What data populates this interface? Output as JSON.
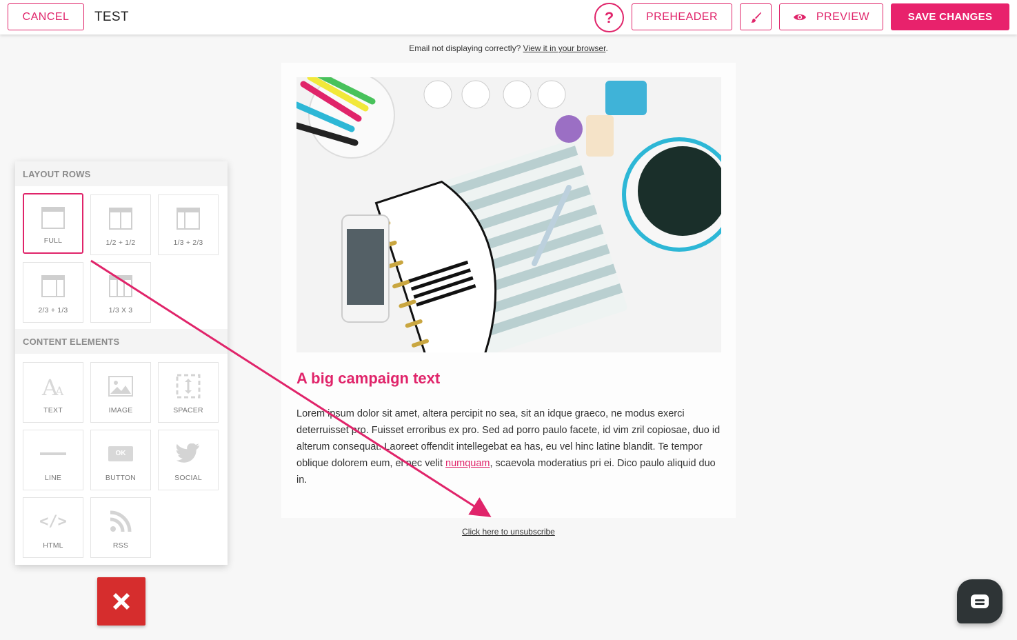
{
  "toolbar": {
    "cancel_label": "CANCEL",
    "title": "TEST",
    "help_label": "?",
    "preheader_label": "PREHEADER",
    "preview_label": "PREVIEW",
    "save_label": "SAVE CHANGES",
    "brush_icon": "brush-icon",
    "eye_icon": "eye-icon"
  },
  "email": {
    "notice_text": "Email not displaying correctly?",
    "notice_link": "View it in your browser",
    "notice_tail": ".",
    "headline": "A big campaign text",
    "body_before_link": "Lorem ipsum dolor sit amet, altera percipit no sea, sit an idque graeco, ne modus exerci deterruisset pro. Fuisset erroribus ex pro. Sed ad porro paulo facete, id vim zril copiosae, duo id alterum consequat. Laoreet offendit intellegebat ea has, eu vel hinc latine blandit. Te tempor oblique dolorem eum, ei nec velit ",
    "body_link": "numquam",
    "body_after_link": ", scaevola moderatius pri ei. Dico paulo aliquid duo in.",
    "unsubscribe": "Click here to unsubscribe",
    "hero_image": "desk-flatlay-photo"
  },
  "panel": {
    "layout_header": "LAYOUT ROWS",
    "layout_rows": [
      {
        "label": "FULL",
        "icon": "full-row-icon",
        "selected": true
      },
      {
        "label": "1/2 + 1/2",
        "icon": "half-half-icon",
        "selected": false
      },
      {
        "label": "1/3 + 2/3",
        "icon": "third-twothirds-icon",
        "selected": false
      },
      {
        "label": "2/3 + 1/3",
        "icon": "twothirds-third-icon",
        "selected": false
      },
      {
        "label": "1/3 X 3",
        "icon": "three-thirds-icon",
        "selected": false
      }
    ],
    "content_header": "CONTENT ELEMENTS",
    "content_elements": [
      {
        "label": "TEXT",
        "icon": "text-icon"
      },
      {
        "label": "IMAGE",
        "icon": "image-icon"
      },
      {
        "label": "SPACER",
        "icon": "spacer-icon"
      },
      {
        "label": "LINE",
        "icon": "line-icon"
      },
      {
        "label": "BUTTON",
        "icon": "button-icon",
        "icon_text": "OK"
      },
      {
        "label": "SOCIAL",
        "icon": "twitter-icon"
      },
      {
        "label": "HTML",
        "icon": "code-icon",
        "icon_text": "</>"
      },
      {
        "label": "RSS",
        "icon": "rss-icon"
      }
    ]
  },
  "colors": {
    "accent": "#e0246a",
    "close": "#d62d2d",
    "chat": "#2e3436"
  }
}
